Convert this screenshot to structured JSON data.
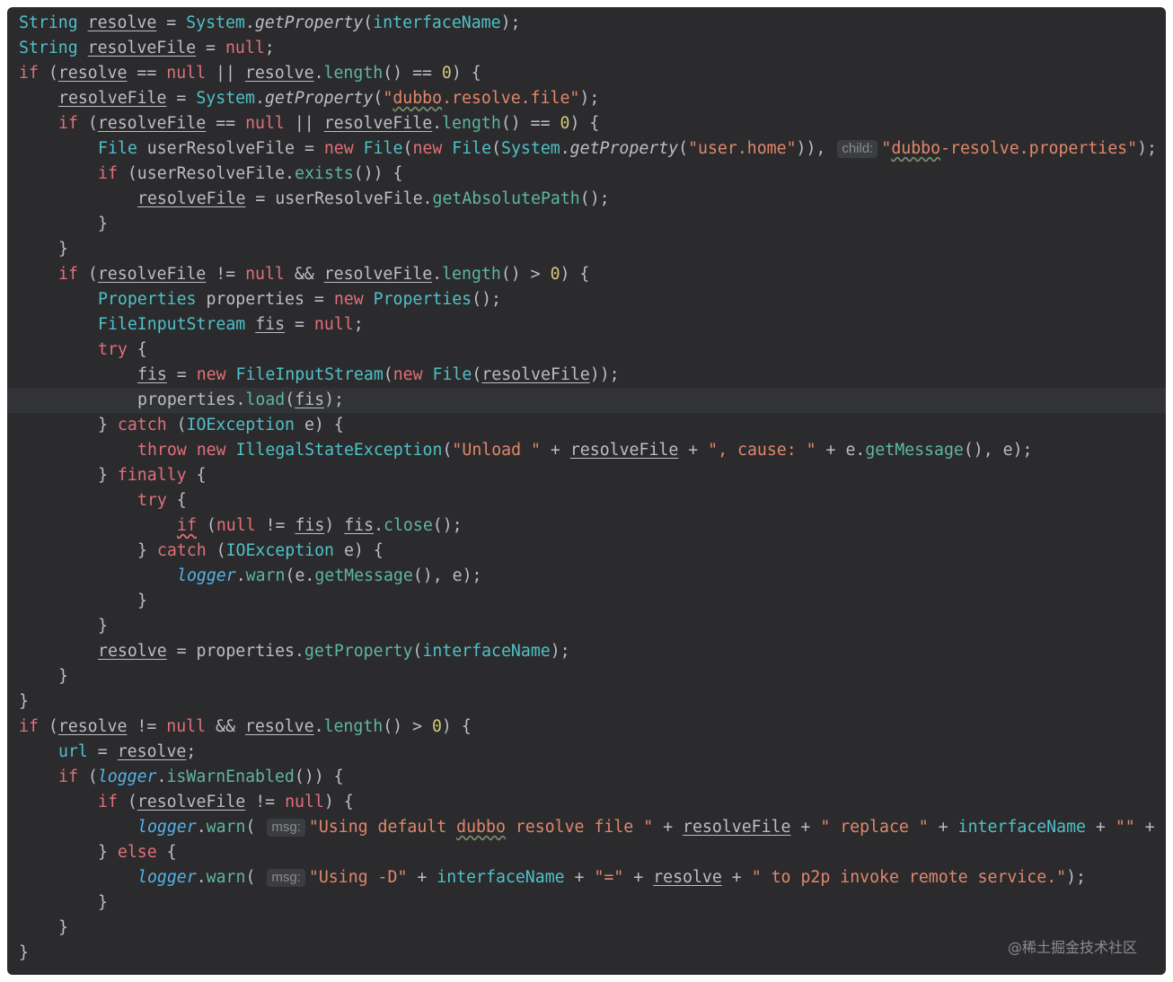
{
  "editor": {
    "lines": [
      {
        "indent": 0,
        "tokens": [
          [
            "c-type",
            "String"
          ],
          [
            "p",
            " "
          ],
          [
            "vu",
            "resolve"
          ],
          [
            "p",
            " = "
          ],
          [
            "c-type",
            "System"
          ],
          [
            "p",
            "."
          ],
          [
            "c-smeth",
            "getProperty"
          ],
          [
            "p",
            "("
          ],
          [
            "c-field",
            "interfaceName"
          ],
          [
            "p",
            ");"
          ]
        ]
      },
      {
        "indent": 0,
        "tokens": [
          [
            "c-type",
            "String"
          ],
          [
            "p",
            " "
          ],
          [
            "vu",
            "resolveFile"
          ],
          [
            "p",
            " = "
          ],
          [
            "c-kw",
            "null"
          ],
          [
            "p",
            ";"
          ]
        ]
      },
      {
        "indent": 0,
        "tokens": [
          [
            "c-kw",
            "if"
          ],
          [
            "p",
            " ("
          ],
          [
            "vu",
            "resolve"
          ],
          [
            "p",
            " == "
          ],
          [
            "c-kw",
            "null"
          ],
          [
            "p",
            " || "
          ],
          [
            "vu",
            "resolve"
          ],
          [
            "p",
            "."
          ],
          [
            "c-meth",
            "length"
          ],
          [
            "p",
            "() == "
          ],
          [
            "c-num",
            "0"
          ],
          [
            "p",
            ") {"
          ]
        ]
      },
      {
        "indent": 1,
        "tokens": [
          [
            "vu",
            "resolveFile"
          ],
          [
            "p",
            " = "
          ],
          [
            "c-type",
            "System"
          ],
          [
            "p",
            "."
          ],
          [
            "c-smeth",
            "getProperty"
          ],
          [
            "p",
            "("
          ],
          [
            "c-str",
            "\""
          ],
          [
            "c-str c-sq",
            "dubbo"
          ],
          [
            "c-str",
            ".resolve.file\""
          ],
          [
            "p",
            ");"
          ]
        ]
      },
      {
        "indent": 1,
        "tokens": [
          [
            "c-kw",
            "if"
          ],
          [
            "p",
            " ("
          ],
          [
            "vu",
            "resolveFile"
          ],
          [
            "p",
            " == "
          ],
          [
            "c-kw",
            "null"
          ],
          [
            "p",
            " || "
          ],
          [
            "vu",
            "resolveFile"
          ],
          [
            "p",
            "."
          ],
          [
            "c-meth",
            "length"
          ],
          [
            "p",
            "() == "
          ],
          [
            "c-num",
            "0"
          ],
          [
            "p",
            ") {"
          ]
        ]
      },
      {
        "indent": 2,
        "tokens": [
          [
            "c-type",
            "File"
          ],
          [
            "p",
            " userResolveFile = "
          ],
          [
            "c-kw",
            "new"
          ],
          [
            "p",
            " "
          ],
          [
            "c-type",
            "File"
          ],
          [
            "p",
            "("
          ],
          [
            "c-kw",
            "new"
          ],
          [
            "p",
            " "
          ],
          [
            "c-type",
            "File"
          ],
          [
            "p",
            "("
          ],
          [
            "c-type",
            "System"
          ],
          [
            "p",
            "."
          ],
          [
            "c-smeth",
            "getProperty"
          ],
          [
            "p",
            "("
          ],
          [
            "c-str",
            "\"user.home\""
          ],
          [
            "p",
            ")), "
          ],
          [
            "hint",
            "child:"
          ],
          [
            "c-str",
            "\""
          ],
          [
            "c-str c-sq",
            "dubbo"
          ],
          [
            "c-str",
            "-resolve.properties\""
          ],
          [
            "p",
            ");"
          ]
        ]
      },
      {
        "indent": 2,
        "tokens": [
          [
            "c-kw",
            "if"
          ],
          [
            "p",
            " (userResolveFile."
          ],
          [
            "c-meth",
            "exists"
          ],
          [
            "p",
            "()) {"
          ]
        ]
      },
      {
        "indent": 3,
        "tokens": [
          [
            "vu",
            "resolveFile"
          ],
          [
            "p",
            " = userResolveFile."
          ],
          [
            "c-meth",
            "getAbsolutePath"
          ],
          [
            "p",
            "();"
          ]
        ]
      },
      {
        "indent": 2,
        "tokens": [
          [
            "p",
            "}"
          ]
        ]
      },
      {
        "indent": 1,
        "tokens": [
          [
            "p",
            "}"
          ]
        ]
      },
      {
        "indent": 1,
        "tokens": [
          [
            "c-kw",
            "if"
          ],
          [
            "p",
            " ("
          ],
          [
            "vu",
            "resolveFile"
          ],
          [
            "p",
            " != "
          ],
          [
            "c-kw",
            "null"
          ],
          [
            "p",
            " && "
          ],
          [
            "vu",
            "resolveFile"
          ],
          [
            "p",
            "."
          ],
          [
            "c-meth",
            "length"
          ],
          [
            "p",
            "() > "
          ],
          [
            "c-num",
            "0"
          ],
          [
            "p",
            ") {"
          ]
        ]
      },
      {
        "indent": 2,
        "tokens": [
          [
            "c-type",
            "Properties"
          ],
          [
            "p",
            " properties = "
          ],
          [
            "c-kw",
            "new"
          ],
          [
            "p",
            " "
          ],
          [
            "c-type",
            "Properties"
          ],
          [
            "p",
            "();"
          ]
        ]
      },
      {
        "indent": 2,
        "tokens": [
          [
            "c-type",
            "FileInputStream"
          ],
          [
            "p",
            " "
          ],
          [
            "vu",
            "fis"
          ],
          [
            "p",
            " = "
          ],
          [
            "c-kw",
            "null"
          ],
          [
            "p",
            ";"
          ]
        ]
      },
      {
        "indent": 2,
        "tokens": [
          [
            "c-kw",
            "try"
          ],
          [
            "p",
            " {"
          ]
        ]
      },
      {
        "indent": 3,
        "tokens": [
          [
            "vu",
            "fis"
          ],
          [
            "p",
            " = "
          ],
          [
            "c-kw",
            "new"
          ],
          [
            "p",
            " "
          ],
          [
            "c-type",
            "FileInputStream"
          ],
          [
            "p",
            "("
          ],
          [
            "c-kw",
            "new"
          ],
          [
            "p",
            " "
          ],
          [
            "c-type",
            "File"
          ],
          [
            "p",
            "("
          ],
          [
            "vu",
            "resolveFile"
          ],
          [
            "p",
            "));"
          ]
        ]
      },
      {
        "indent": 3,
        "highlight": true,
        "tokens": [
          [
            "p",
            "properties."
          ],
          [
            "c-meth",
            "load"
          ],
          [
            "p",
            "("
          ],
          [
            "vu",
            "fis"
          ],
          [
            "p",
            ");"
          ]
        ]
      },
      {
        "indent": 2,
        "tokens": [
          [
            "p",
            "} "
          ],
          [
            "c-kw",
            "catch"
          ],
          [
            "p",
            " ("
          ],
          [
            "c-type",
            "IOException"
          ],
          [
            "p",
            " e) {"
          ]
        ]
      },
      {
        "indent": 3,
        "tokens": [
          [
            "c-kw",
            "throw"
          ],
          [
            "p",
            " "
          ],
          [
            "c-kw",
            "new"
          ],
          [
            "p",
            " "
          ],
          [
            "c-type",
            "IllegalStateException"
          ],
          [
            "p",
            "("
          ],
          [
            "c-str",
            "\"Unload \""
          ],
          [
            "p",
            " + "
          ],
          [
            "vu",
            "resolveFile"
          ],
          [
            "p",
            " + "
          ],
          [
            "c-str",
            "\", cause: \""
          ],
          [
            "p",
            " + e."
          ],
          [
            "c-meth",
            "getMessage"
          ],
          [
            "p",
            "(), e);"
          ]
        ]
      },
      {
        "indent": 2,
        "tokens": [
          [
            "p",
            "} "
          ],
          [
            "c-kw",
            "finally"
          ],
          [
            "p",
            " {"
          ]
        ]
      },
      {
        "indent": 3,
        "tokens": [
          [
            "c-kw",
            "try"
          ],
          [
            "p",
            " {"
          ]
        ]
      },
      {
        "indent": 4,
        "tokens": [
          [
            "c-warn",
            "if"
          ],
          [
            "p",
            " ("
          ],
          [
            "c-kw",
            "null"
          ],
          [
            "p",
            " != "
          ],
          [
            "vu",
            "fis"
          ],
          [
            "p",
            ") "
          ],
          [
            "vu",
            "fis"
          ],
          [
            "p",
            "."
          ],
          [
            "c-meth",
            "close"
          ],
          [
            "p",
            "();"
          ]
        ]
      },
      {
        "indent": 3,
        "tokens": [
          [
            "p",
            "} "
          ],
          [
            "c-kw",
            "catch"
          ],
          [
            "p",
            " ("
          ],
          [
            "c-type",
            "IOException"
          ],
          [
            "p",
            " e) {"
          ]
        ]
      },
      {
        "indent": 4,
        "tokens": [
          [
            "c-lfield",
            "logger"
          ],
          [
            "p",
            "."
          ],
          [
            "c-meth",
            "warn"
          ],
          [
            "p",
            "(e."
          ],
          [
            "c-meth",
            "getMessage"
          ],
          [
            "p",
            "(), e);"
          ]
        ]
      },
      {
        "indent": 3,
        "tokens": [
          [
            "p",
            "}"
          ]
        ]
      },
      {
        "indent": 2,
        "tokens": [
          [
            "p",
            "}"
          ]
        ]
      },
      {
        "indent": 2,
        "tokens": [
          [
            "vu",
            "resolve"
          ],
          [
            "p",
            " = properties."
          ],
          [
            "c-meth",
            "getProperty"
          ],
          [
            "p",
            "("
          ],
          [
            "c-field",
            "interfaceName"
          ],
          [
            "p",
            ");"
          ]
        ]
      },
      {
        "indent": 1,
        "tokens": [
          [
            "p",
            "}"
          ]
        ]
      },
      {
        "indent": 0,
        "tokens": [
          [
            "p",
            "}"
          ]
        ]
      },
      {
        "indent": 0,
        "tokens": [
          [
            "c-kw",
            "if"
          ],
          [
            "p",
            " ("
          ],
          [
            "vu",
            "resolve"
          ],
          [
            "p",
            " != "
          ],
          [
            "c-kw",
            "null"
          ],
          [
            "p",
            " && "
          ],
          [
            "vu",
            "resolve"
          ],
          [
            "p",
            "."
          ],
          [
            "c-meth",
            "length"
          ],
          [
            "p",
            "() > "
          ],
          [
            "c-num",
            "0"
          ],
          [
            "p",
            ") {"
          ]
        ]
      },
      {
        "indent": 1,
        "tokens": [
          [
            "c-field",
            "url"
          ],
          [
            "p",
            " = "
          ],
          [
            "vu",
            "resolve"
          ],
          [
            "p",
            ";"
          ]
        ]
      },
      {
        "indent": 1,
        "tokens": [
          [
            "c-kw",
            "if"
          ],
          [
            "p",
            " ("
          ],
          [
            "c-lfield",
            "logger"
          ],
          [
            "p",
            "."
          ],
          [
            "c-meth",
            "isWarnEnabled"
          ],
          [
            "p",
            "()) {"
          ]
        ]
      },
      {
        "indent": 2,
        "tokens": [
          [
            "c-kw",
            "if"
          ],
          [
            "p",
            " ("
          ],
          [
            "vu",
            "resolveFile"
          ],
          [
            "p",
            " != "
          ],
          [
            "c-kw",
            "null"
          ],
          [
            "p",
            ") {"
          ]
        ]
      },
      {
        "indent": 3,
        "tokens": [
          [
            "c-lfield",
            "logger"
          ],
          [
            "p",
            "."
          ],
          [
            "c-meth",
            "warn"
          ],
          [
            "p",
            "( "
          ],
          [
            "hint",
            "msg:"
          ],
          [
            "c-str",
            "\"Using default "
          ],
          [
            "c-str c-sq",
            "dubbo"
          ],
          [
            "c-str",
            " resolve file \""
          ],
          [
            "p",
            " + "
          ],
          [
            "vu",
            "resolveFile"
          ],
          [
            "p",
            " + "
          ],
          [
            "c-str",
            "\" replace \""
          ],
          [
            "p",
            " + "
          ],
          [
            "c-field",
            "interfaceName"
          ],
          [
            "p",
            " + "
          ],
          [
            "c-str",
            "\"\""
          ],
          [
            "p",
            " + "
          ]
        ]
      },
      {
        "indent": 2,
        "tokens": [
          [
            "p",
            "} "
          ],
          [
            "c-kw",
            "else"
          ],
          [
            "p",
            " {"
          ]
        ]
      },
      {
        "indent": 3,
        "tokens": [
          [
            "c-lfield",
            "logger"
          ],
          [
            "p",
            "."
          ],
          [
            "c-meth",
            "warn"
          ],
          [
            "p",
            "( "
          ],
          [
            "hint",
            "msg:"
          ],
          [
            "c-str",
            "\"Using -D\""
          ],
          [
            "p",
            " + "
          ],
          [
            "c-field",
            "interfaceName"
          ],
          [
            "p",
            " + "
          ],
          [
            "c-str",
            "\"=\""
          ],
          [
            "p",
            " + "
          ],
          [
            "vu",
            "resolve"
          ],
          [
            "p",
            " + "
          ],
          [
            "c-str",
            "\" to p2p invoke remote service.\""
          ],
          [
            "p",
            ");"
          ]
        ]
      },
      {
        "indent": 2,
        "tokens": [
          [
            "p",
            "}"
          ]
        ]
      },
      {
        "indent": 1,
        "tokens": [
          [
            "p",
            "}"
          ]
        ]
      },
      {
        "indent": 0,
        "tokens": [
          [
            "p",
            "}"
          ]
        ]
      }
    ]
  },
  "watermark": "@稀土掘金技术社区"
}
